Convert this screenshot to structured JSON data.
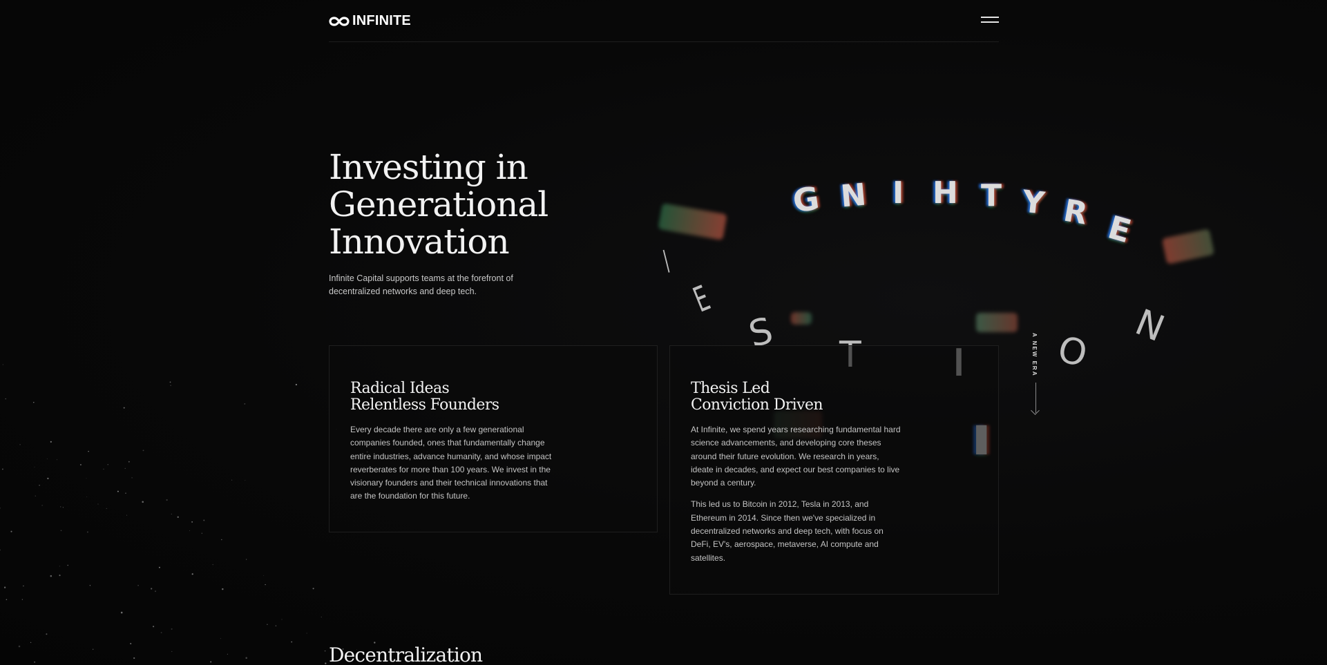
{
  "header": {
    "logo_text": "INFINITE",
    "logo_icon": "infinity-icon",
    "menu_icon": "hamburger-menu-icon"
  },
  "hero": {
    "title_lines": [
      "Investing in",
      "Generational",
      "Innovation"
    ],
    "subtitle": "Infinite Capital supports teams at the forefront of decentralized networks and deep tech."
  },
  "cards": [
    {
      "title_lines": [
        "Radical Ideas",
        "Relentless Founders"
      ],
      "paragraphs": [
        "Every decade there are only a few generational companies founded, ones that fundamentally change entire industries, advance humanity, and whose impact reverberates for more than 100 years. We invest in the visionary founders and their technical innovations that are the foundation for this future."
      ]
    },
    {
      "title_lines": [
        "Thesis Led",
        "Conviction Driven"
      ],
      "paragraphs": [
        "At Infinite, we spend years researching fundamental hard science advancements, and developing core theses around their future evolution. We research in years, ideate in decades, and expect our best companies to live beyond a century.",
        "This led us to Bitcoin in 2012, Tesla in 2013, and Ethereum in 2014. Since then we've specialized in decentralized networks and deep tech, with focus on DeFi, EV's, aerospace, metaverse, AI compute and satellites."
      ]
    }
  ],
  "side_label": "A NEW ERA",
  "ring_letters": {
    "top": [
      "G",
      "N",
      "I",
      "H",
      "T",
      "Y",
      "R",
      "E"
    ],
    "bottom": [
      "I",
      "E",
      "S",
      "T",
      "I",
      "O",
      "N"
    ],
    "lower": [
      "I"
    ]
  },
  "next_section_title": "Decentralization",
  "colors": {
    "background": "#070707",
    "text": "#f2f2f2",
    "muted": "#c4c4c4",
    "border": "#1f1f1f"
  }
}
